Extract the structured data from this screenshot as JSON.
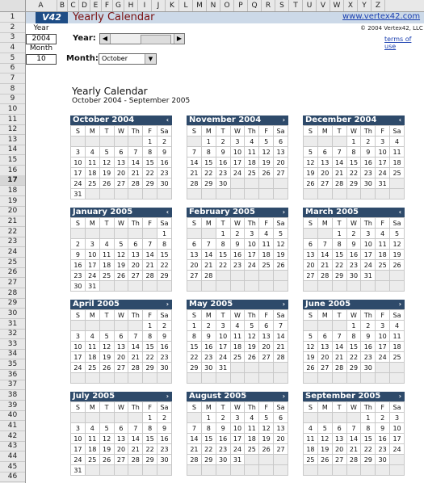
{
  "column_headers": [
    "A",
    "B",
    "C",
    "D",
    "E",
    "F",
    "G",
    "H",
    "I",
    "J",
    "K",
    "L",
    "M",
    "N",
    "O",
    "P",
    "Q",
    "R",
    "S",
    "T",
    "U",
    "V",
    "W",
    "X",
    "Y",
    "Z"
  ],
  "row_headers": [
    "1",
    "2",
    "3",
    "4",
    "5",
    "6",
    "7",
    "8",
    "9",
    "10",
    "11",
    "12",
    "13",
    "14",
    "15",
    "16",
    "17",
    "18",
    "19",
    "20",
    "21",
    "22",
    "23",
    "24",
    "25",
    "26",
    "27",
    "28",
    "29",
    "30",
    "31",
    "32",
    "33",
    "34",
    "35",
    "36",
    "37",
    "38",
    "39",
    "40",
    "41",
    "42",
    "43",
    "44",
    "45",
    "46"
  ],
  "header": {
    "logo": "V42",
    "title": "Yearly Calendar",
    "website": "www.vertex42.com",
    "copyright": "© 2004 Vertex42, LLC",
    "terms": "terms of use"
  },
  "sidebar": {
    "year_label": "Year",
    "year_value": "2004",
    "month_label": "Month",
    "month_value": "10"
  },
  "controls": {
    "year_label": "Year:",
    "month_label": "Month:",
    "month_select": "October"
  },
  "calendar": {
    "title": "Yearly Calendar",
    "subtitle": "October 2004 - September 2005",
    "weekdays": [
      "S",
      "M",
      "T",
      "W",
      "Th",
      "F",
      "Sa"
    ],
    "months": [
      {
        "name": "October 2004",
        "nav": "‹",
        "weeks": [
          [
            "",
            "",
            "",
            "",
            "",
            "1",
            "2"
          ],
          [
            "3",
            "4",
            "5",
            "6",
            "7",
            "8",
            "9"
          ],
          [
            "10",
            "11",
            "12",
            "13",
            "14",
            "15",
            "16"
          ],
          [
            "17",
            "18",
            "19",
            "20",
            "21",
            "22",
            "23"
          ],
          [
            "24",
            "25",
            "26",
            "27",
            "28",
            "29",
            "30"
          ],
          [
            "31",
            "",
            "",
            "",
            "",
            "",
            ""
          ]
        ]
      },
      {
        "name": "November 2004",
        "nav": "›",
        "weeks": [
          [
            "",
            "1",
            "2",
            "3",
            "4",
            "5",
            "6"
          ],
          [
            "7",
            "8",
            "9",
            "10",
            "11",
            "12",
            "13"
          ],
          [
            "14",
            "15",
            "16",
            "17",
            "18",
            "19",
            "20"
          ],
          [
            "21",
            "22",
            "23",
            "24",
            "25",
            "26",
            "27"
          ],
          [
            "28",
            "29",
            "30",
            "",
            "",
            "",
            ""
          ],
          [
            "",
            "",
            "",
            "",
            "",
            "",
            ""
          ]
        ]
      },
      {
        "name": "December 2004",
        "nav": "‹",
        "weeks": [
          [
            "",
            "",
            "",
            "1",
            "2",
            "3",
            "4"
          ],
          [
            "5",
            "6",
            "7",
            "8",
            "9",
            "10",
            "11"
          ],
          [
            "12",
            "13",
            "14",
            "15",
            "16",
            "17",
            "18"
          ],
          [
            "19",
            "20",
            "21",
            "22",
            "23",
            "24",
            "25"
          ],
          [
            "26",
            "27",
            "28",
            "29",
            "30",
            "31",
            ""
          ],
          [
            "",
            "",
            "",
            "",
            "",
            "",
            ""
          ]
        ]
      },
      {
        "name": "January 2005",
        "nav": "‹",
        "weeks": [
          [
            "",
            "",
            "",
            "",
            "",
            "",
            "1"
          ],
          [
            "2",
            "3",
            "4",
            "5",
            "6",
            "7",
            "8"
          ],
          [
            "9",
            "10",
            "11",
            "12",
            "13",
            "14",
            "15"
          ],
          [
            "16",
            "17",
            "18",
            "19",
            "20",
            "21",
            "22"
          ],
          [
            "23",
            "24",
            "25",
            "26",
            "27",
            "28",
            "29"
          ],
          [
            "30",
            "31",
            "",
            "",
            "",
            "",
            ""
          ]
        ]
      },
      {
        "name": "February 2005",
        "nav": "›",
        "weeks": [
          [
            "",
            "",
            "1",
            "2",
            "3",
            "4",
            "5"
          ],
          [
            "6",
            "7",
            "8",
            "9",
            "10",
            "11",
            "12"
          ],
          [
            "13",
            "14",
            "15",
            "16",
            "17",
            "18",
            "19"
          ],
          [
            "20",
            "21",
            "22",
            "23",
            "24",
            "25",
            "26"
          ],
          [
            "27",
            "28",
            "",
            "",
            "",
            "",
            ""
          ],
          [
            "",
            "",
            "",
            "",
            "",
            "",
            ""
          ]
        ]
      },
      {
        "name": "March 2005",
        "nav": "‹",
        "weeks": [
          [
            "",
            "",
            "1",
            "2",
            "3",
            "4",
            "5"
          ],
          [
            "6",
            "7",
            "8",
            "9",
            "10",
            "11",
            "12"
          ],
          [
            "13",
            "14",
            "15",
            "16",
            "17",
            "18",
            "19"
          ],
          [
            "20",
            "21",
            "22",
            "23",
            "24",
            "25",
            "26"
          ],
          [
            "27",
            "28",
            "29",
            "30",
            "31",
            "",
            ""
          ],
          [
            "",
            "",
            "",
            "",
            "",
            "",
            ""
          ]
        ]
      },
      {
        "name": "April 2005",
        "nav": "›",
        "weeks": [
          [
            "",
            "",
            "",
            "",
            "",
            "1",
            "2"
          ],
          [
            "3",
            "4",
            "5",
            "6",
            "7",
            "8",
            "9"
          ],
          [
            "10",
            "11",
            "12",
            "13",
            "14",
            "15",
            "16"
          ],
          [
            "17",
            "18",
            "19",
            "20",
            "21",
            "22",
            "23"
          ],
          [
            "24",
            "25",
            "26",
            "27",
            "28",
            "29",
            "30"
          ],
          [
            "",
            "",
            "",
            "",
            "",
            "",
            ""
          ]
        ]
      },
      {
        "name": "May 2005",
        "nav": "›",
        "weeks": [
          [
            "1",
            "2",
            "3",
            "4",
            "5",
            "6",
            "7"
          ],
          [
            "8",
            "9",
            "10",
            "11",
            "12",
            "13",
            "14"
          ],
          [
            "15",
            "16",
            "17",
            "18",
            "19",
            "20",
            "21"
          ],
          [
            "22",
            "23",
            "24",
            "25",
            "26",
            "27",
            "28"
          ],
          [
            "29",
            "30",
            "31",
            "",
            "",
            "",
            ""
          ],
          [
            "",
            "",
            "",
            "",
            "",
            "",
            ""
          ]
        ]
      },
      {
        "name": "June 2005",
        "nav": "›",
        "weeks": [
          [
            "",
            "",
            "",
            "1",
            "2",
            "3",
            "4"
          ],
          [
            "5",
            "6",
            "7",
            "8",
            "9",
            "10",
            "11"
          ],
          [
            "12",
            "13",
            "14",
            "15",
            "16",
            "17",
            "18"
          ],
          [
            "19",
            "20",
            "21",
            "22",
            "23",
            "24",
            "25"
          ],
          [
            "26",
            "27",
            "28",
            "29",
            "30",
            "",
            ""
          ],
          [
            "",
            "",
            "",
            "",
            "",
            "",
            ""
          ]
        ]
      },
      {
        "name": "July 2005",
        "nav": "›",
        "weeks": [
          [
            "",
            "",
            "",
            "",
            "",
            "1",
            "2"
          ],
          [
            "3",
            "4",
            "5",
            "6",
            "7",
            "8",
            "9"
          ],
          [
            "10",
            "11",
            "12",
            "13",
            "14",
            "15",
            "16"
          ],
          [
            "17",
            "18",
            "19",
            "20",
            "21",
            "22",
            "23"
          ],
          [
            "24",
            "25",
            "26",
            "27",
            "28",
            "29",
            "30"
          ],
          [
            "31",
            "",
            "",
            "",
            "",
            "",
            ""
          ]
        ]
      },
      {
        "name": "August 2005",
        "nav": "›",
        "weeks": [
          [
            "",
            "1",
            "2",
            "3",
            "4",
            "5",
            "6"
          ],
          [
            "7",
            "8",
            "9",
            "10",
            "11",
            "12",
            "13"
          ],
          [
            "14",
            "15",
            "16",
            "17",
            "18",
            "19",
            "20"
          ],
          [
            "21",
            "22",
            "23",
            "24",
            "25",
            "26",
            "27"
          ],
          [
            "28",
            "29",
            "30",
            "31",
            "",
            "",
            ""
          ],
          [
            "",
            "",
            "",
            "",
            "",
            "",
            ""
          ]
        ]
      },
      {
        "name": "September 2005",
        "nav": "›",
        "weeks": [
          [
            "",
            "",
            "",
            "",
            "1",
            "2",
            "3"
          ],
          [
            "4",
            "5",
            "6",
            "7",
            "8",
            "9",
            "10"
          ],
          [
            "11",
            "12",
            "13",
            "14",
            "15",
            "16",
            "17"
          ],
          [
            "18",
            "19",
            "20",
            "21",
            "22",
            "23",
            "24"
          ],
          [
            "25",
            "26",
            "27",
            "28",
            "29",
            "30",
            ""
          ],
          [
            "",
            "",
            "",
            "",
            "",
            "",
            ""
          ]
        ]
      }
    ]
  },
  "colors": {
    "month_header": "#2e4a6a",
    "banner": "#ccd9e8",
    "title": "#7a1010",
    "link": "#1a3fb0"
  },
  "selected_row": "17"
}
